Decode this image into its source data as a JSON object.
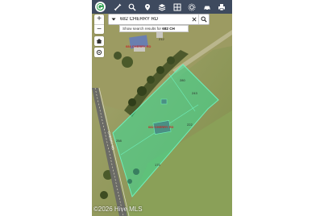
{
  "toolbar": {
    "logo_icon": "mls-logo-icon",
    "tools": [
      {
        "name": "measure-icon"
      },
      {
        "name": "zoom-search-icon"
      },
      {
        "name": "pin-icon"
      },
      {
        "name": "layers-icon"
      },
      {
        "name": "grid-icon"
      },
      {
        "name": "camera-icon"
      },
      {
        "name": "car-icon"
      },
      {
        "name": "print-icon"
      }
    ],
    "background": "#3e4a5e"
  },
  "search": {
    "value": "682 CHERRY RD",
    "suggestion_prefix": "Show search results for",
    "suggestion_query": "682 CH"
  },
  "map": {
    "parcel_label": "682 CHERRY RD",
    "parcel_highlight_color": "#3ddc97",
    "neighbor_label": "684 CHERRY RD",
    "dimensions": [
      "280",
      "243",
      "222",
      "258",
      "175",
      "212"
    ],
    "road_label": "CHERRY RD",
    "copyright": "©2026 Hive MLS"
  }
}
